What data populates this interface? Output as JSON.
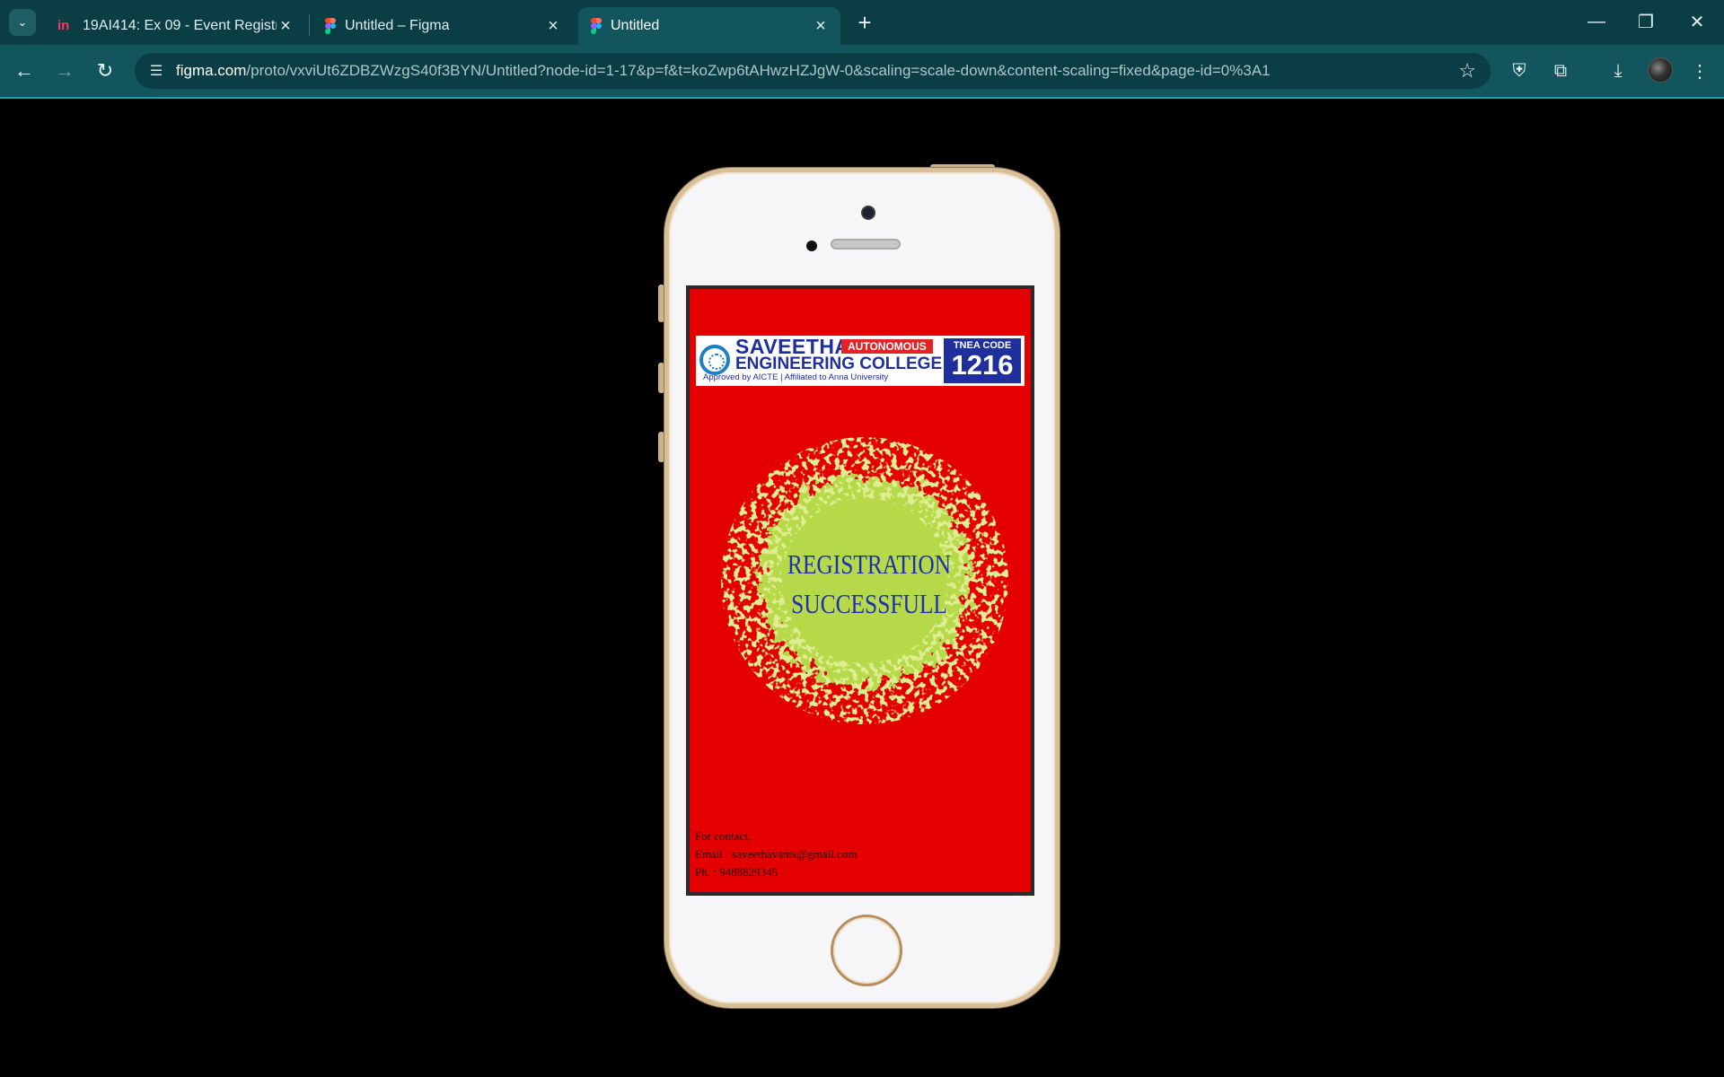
{
  "browser": {
    "tabs": [
      {
        "title": "19AI414: Ex 09 - Event Registrat",
        "icon": "invision-icon"
      },
      {
        "title": "Untitled – Figma",
        "icon": "figma-icon"
      },
      {
        "title": "Untitled",
        "icon": "figma-icon",
        "active": true
      }
    ],
    "url_host": "figma.com",
    "url_path": "/proto/vxviUt6ZDBZWzgS40f3BYN/Untitled?node-id=1-17&p=f&t=koZwp6tAHwzHZJgW-0&scaling=scale-down&content-scaling=fixed&page-id=0%3A1",
    "theme_color": "#12555d"
  },
  "screen": {
    "background": "#e50000",
    "logo": {
      "name": "SAVEETHA",
      "badge": "AUTONOMOUS",
      "subtitle": "ENGINEERING COLLEGE",
      "tagline": "Approved by AICTE  |  Affiliated to Anna University",
      "tnea_label": "TNEA CODE",
      "tnea_code": "1216"
    },
    "message_line1": "REGISTRATION",
    "message_line2": "SUCCESSFULL",
    "contact": {
      "heading": "For contact,",
      "email": "Email : saveethavants@gmail.com",
      "phone": "Ph. : 9488829345"
    }
  }
}
